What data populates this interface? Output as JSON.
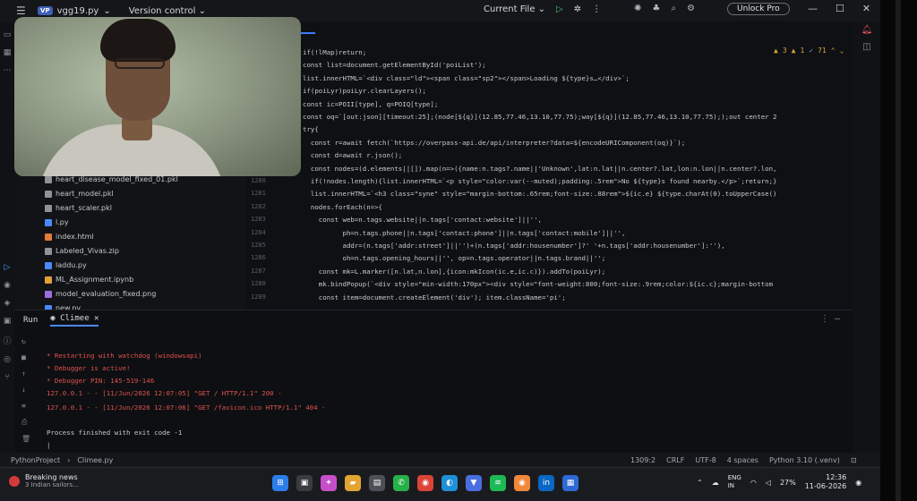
{
  "titlebar": {
    "project_badge": "VP",
    "file": "vgg19.py",
    "version_control": "Version control",
    "run_config": "Current File",
    "unlock": "Unlock Pro"
  },
  "tree": {
    "items": [
      {
        "name": "heart_disease_model_fixed_01.pkl",
        "color": "#8f9399"
      },
      {
        "name": "heart_model.pkl",
        "color": "#8f9399"
      },
      {
        "name": "heart_scaler.pkl",
        "color": "#8f9399"
      },
      {
        "name": "l.py",
        "color": "#4a88ff"
      },
      {
        "name": "index.html",
        "color": "#e07b39"
      },
      {
        "name": "Labeled_Vivas.zip",
        "color": "#8f9399"
      },
      {
        "name": "laddu.py",
        "color": "#4a88ff"
      },
      {
        "name": "ML_Assignment.ipynb",
        "color": "#e0a03b"
      },
      {
        "name": "model_evaluation_fixed.png",
        "color": "#9a6ee0"
      },
      {
        "name": "new.py",
        "color": "#4a88ff"
      }
    ]
  },
  "editor": {
    "inspection": {
      "warnings": "3",
      "weak": "1",
      "typos": "71"
    },
    "line_numbers": [
      "1279",
      "1280",
      "1281",
      "1282",
      "1283",
      "1284",
      "1285",
      "1286",
      "1287",
      "1288",
      "1289"
    ],
    "lines": [
      "if(!lMap)return;",
      "const list=document.getElementById('poiList');",
      "list.innerHTML=`<div class=\"ld\"><span class=\"sp2\"></span>Loading ${type}s…</div>`;",
      "if(poiLyr)poiLyr.clearLayers();",
      "const ic=POII[type], q=POIQ[type];",
      "const oq=`[out:json][timeout:25];(node[${q}](12.85,77.46,13.10,77.75);way[${q}](12.85,77.46,13.10,77.75););out center 2",
      "try{",
      "  const r=await fetch(`https://overpass-api.de/api/interpreter?data=${encodeURIComponent(oq)}`);",
      "  const d=await r.json();",
      "  const nodes=(d.elements||[]).map(n=>({name:n.tags?.name||'Unknown',lat:n.lat||n.center?.lat,lon:n.lon||n.center?.lon,",
      "  if(!nodes.length){list.innerHTML=`<p style=\"color:var(--muted);padding:.5rem\">No ${type}s found nearby.</p>`;return;}",
      "  list.innerHTML=`<h3 class=\"syne\" style=\"margin-bottom:.65rem;font-size:.88rem\">${ic.e} ${type.charAt(0).toUpperCase()",
      "  nodes.forEach(n=>{",
      "    const web=n.tags.website||n.tags['contact:website']||'',",
      "          ph=n.tags.phone||n.tags['contact:phone']||n.tags['contact:mobile']||'',",
      "          addr=(n.tags['addr:street']||'')+(n.tags['addr:housenumber']?' '+n.tags['addr:housenumber']:''),",
      "          oh=n.tags.opening_hours||'', op=n.tags.operator||n.tags.brand||'';",
      "    const mk=L.marker([n.lat,n.lon],{icon:mkIcon(ic.e,ic.c)}).addTo(poiLyr);",
      "    mk.bindPopup(`<div style=\"min-width:170px\"><div style=\"font-weight:800;font-size:.9rem;color:${ic.c};margin-bottom",
      "    const item=document.createElement('div'); item.className='pi';"
    ]
  },
  "run": {
    "label": "Run",
    "tab": "Climee",
    "output": [
      {
        "text": "* Restarting with watchdog (windowsapi)",
        "kind": "red"
      },
      {
        "text": "* Debugger is active!",
        "kind": "red"
      },
      {
        "text": "* Debugger PIN: 145-519-146",
        "kind": "red"
      },
      {
        "text": "127.0.0.1 - - [11/Jun/2026 12:07:05] \"GET / HTTP/1.1\" 200 -",
        "kind": "red"
      },
      {
        "text": "127.0.0.1 - - [11/Jun/2026 12:07:06] \"GET /favicon.ico HTTP/1.1\" 404 -",
        "kind": "red"
      },
      {
        "text": "Process finished with exit code -1",
        "kind": "gray"
      }
    ]
  },
  "status": {
    "breadcrumb": [
      "PythonProject",
      "Climee.py"
    ],
    "position": "1309:2",
    "line_sep": "CRLF",
    "encoding": "UTF-8",
    "indent": "4 spaces",
    "interpreter": "Python 3.10 (.venv)"
  },
  "taskbar": {
    "news_title": "Breaking news",
    "news_sub": "3 Indian sailors...",
    "lang_top": "ENG",
    "lang_bottom": "IN",
    "battery": "27%",
    "time": "12:36",
    "date": "11-06-2026"
  }
}
